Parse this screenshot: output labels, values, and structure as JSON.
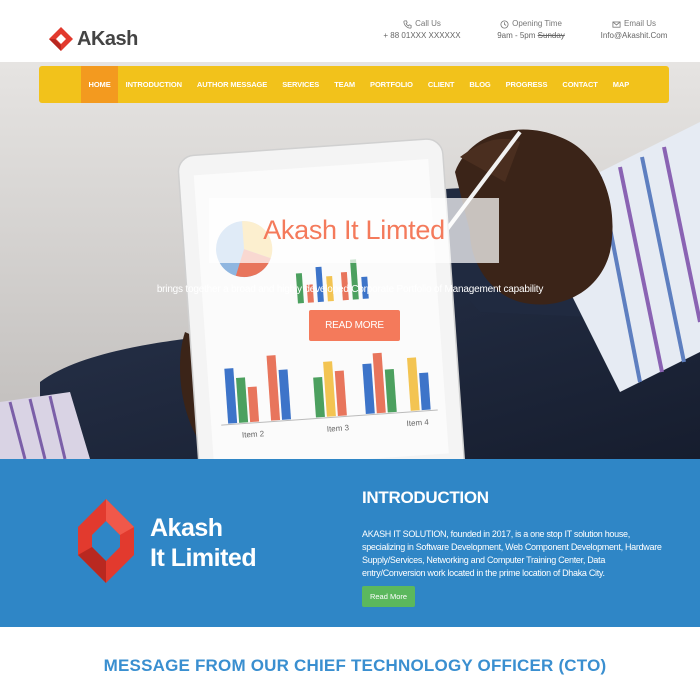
{
  "brand": {
    "name": "AKash",
    "accent": "#e23a2e"
  },
  "header": {
    "call": {
      "icon": "phone-icon",
      "label": "Call Us",
      "value": "+ 88 01XXX XXXXXX"
    },
    "hours": {
      "icon": "clock-icon",
      "label": "Opening Time",
      "value": "9am - 5pm",
      "struck": "Sunday"
    },
    "email": {
      "icon": "mail-icon",
      "label": "Email Us",
      "value": "Info@Akashit.Com"
    }
  },
  "nav": {
    "items": [
      {
        "label": "HOME",
        "active": true
      },
      {
        "label": "INTRODUCTION",
        "active": false
      },
      {
        "label": "AUTHOR MESSAGE",
        "active": false
      },
      {
        "label": "SERVICES",
        "active": false
      },
      {
        "label": "TEAM",
        "active": false
      },
      {
        "label": "PORTFOLIO",
        "active": false
      },
      {
        "label": "CLIENT",
        "active": false
      },
      {
        "label": "BLOG",
        "active": false
      },
      {
        "label": "PROGRESS",
        "active": false
      },
      {
        "label": "CONTACT",
        "active": false
      },
      {
        "label": "MAP",
        "active": false
      }
    ],
    "bg": "#f2c21b",
    "active_bg": "#f39a1f"
  },
  "hero": {
    "title": "Akash It Limted",
    "subtitle": "brings together a broad and highly developed Corporate Portfolio of Management capability",
    "button": "READ MORE",
    "tablet_labels": [
      "Item 2",
      "Item 3",
      "Item 4"
    ],
    "accent": "#f47a5b"
  },
  "intro": {
    "logo_line1": "Akash",
    "logo_line2": "It Limited",
    "heading": "INTRODUCTION",
    "body": "AKASH IT SOLUTION, founded in 2017, is a one stop IT solution house, specializing in Software Development, Web Component Development, Hardware Supply/Services, Networking and Computer Training Center, Data entry/Conversion work located in the prime location of Dhaka City.",
    "button": "Read More",
    "bg": "#2f86c6"
  },
  "cto": {
    "heading": "MESSAGE FROM OUR CHIEF TECHNOLOGY OFFICER (CTO)",
    "color": "#3a8fd0"
  }
}
